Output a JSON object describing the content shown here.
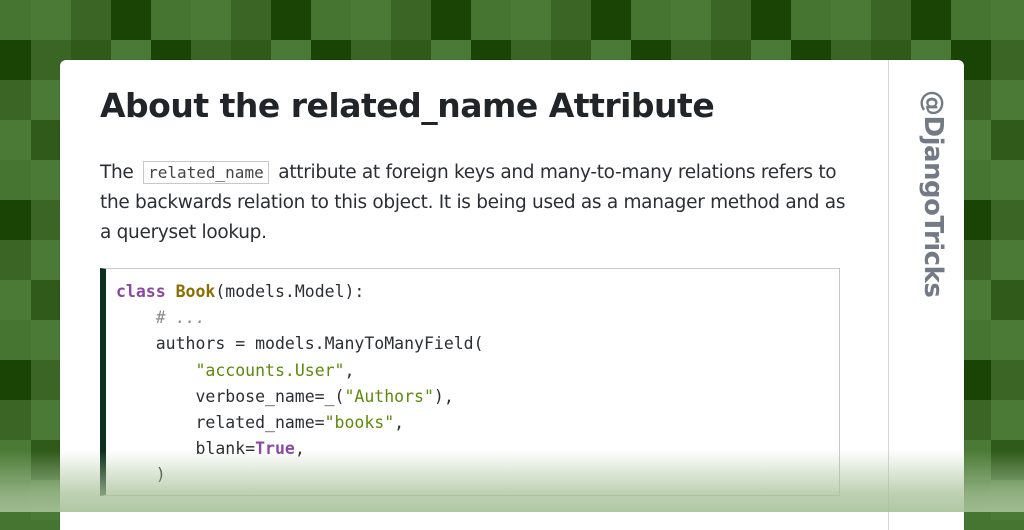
{
  "colors": {
    "background_shades": [
      "#1a4306",
      "#2f5a1a",
      "#3a6524",
      "#457530",
      "#4b7a36"
    ],
    "code_accent_bar": "#0c2f1e",
    "keyword": "#8a4aa3",
    "class_name": "#8c6d00",
    "string": "#5d8a0a",
    "comment": "#8a8a8a"
  },
  "card": {
    "title": "About the related_name Attribute",
    "paragraph": {
      "before_code": "The",
      "inline_code": "related_name",
      "after_code": "attribute at foreign keys and many-to-many relations refers to the backwards relation to this object. It is being used as a manager method and as a queryset lookup."
    },
    "code_block": {
      "language": "python",
      "lines": [
        [
          {
            "t": "kw",
            "v": "class"
          },
          {
            "t": "",
            "v": " "
          },
          {
            "t": "cls",
            "v": "Book"
          },
          {
            "t": "",
            "v": "(models.Model):"
          }
        ],
        [
          {
            "t": "",
            "v": "    "
          },
          {
            "t": "cm",
            "v": "# ..."
          }
        ],
        [
          {
            "t": "",
            "v": "    authors = models.ManyToManyField("
          }
        ],
        [
          {
            "t": "",
            "v": "        "
          },
          {
            "t": "str",
            "v": "\"accounts.User\""
          },
          {
            "t": "",
            "v": ","
          }
        ],
        [
          {
            "t": "",
            "v": "        verbose_name=_("
          },
          {
            "t": "str",
            "v": "\"Authors\""
          },
          {
            "t": "",
            "v": "),"
          }
        ],
        [
          {
            "t": "",
            "v": "        related_name="
          },
          {
            "t": "str",
            "v": "\"books\""
          },
          {
            "t": "",
            "v": ","
          }
        ],
        [
          {
            "t": "",
            "v": "        blank="
          },
          {
            "t": "kw",
            "v": "True"
          },
          {
            "t": "",
            "v": ","
          }
        ],
        [
          {
            "t": "",
            "v": "    )"
          }
        ]
      ]
    },
    "handle": "@DjangoTricks"
  }
}
